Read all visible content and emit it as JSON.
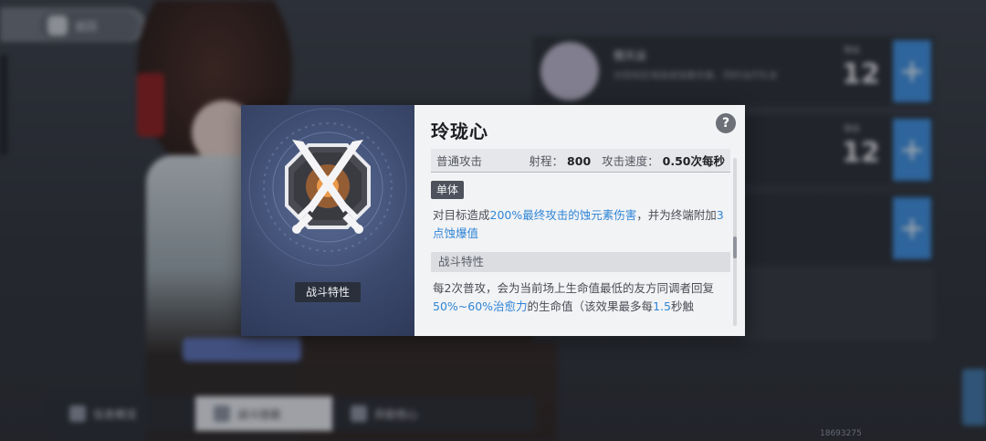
{
  "background": {
    "back_button_label": "返回",
    "refresh_icon": "refresh-icon",
    "help_icon": "?",
    "slots": [
      {
        "name": "闇天运",
        "desc": "对目标区域造成蚀素伤害，同时治疗队友",
        "level": "12",
        "level_tag": "等级",
        "plus": "+"
      },
      {
        "name": "",
        "desc": "",
        "level": "12",
        "level_tag": "等级",
        "plus": "+"
      },
      {
        "name": "",
        "desc": "",
        "level": "",
        "level_tag": "",
        "plus": "+"
      }
    ],
    "tabs": [
      {
        "label": "信息概览",
        "active": false
      },
      {
        "label": "战斗技能",
        "active": true
      },
      {
        "label": "异能核心",
        "active": false
      }
    ],
    "watermark": "18693275"
  },
  "card": {
    "icon_label": "战斗特性",
    "title": "玲珑心",
    "help": "?",
    "normal_attack": {
      "label": "普通攻击",
      "range_label": "射程：",
      "range_value": "800",
      "speed_label": "攻击速度：",
      "speed_value": "0.50次每秒"
    },
    "tag": "单体",
    "desc1": {
      "p1": "对目标造成",
      "h1": "200%最终攻击的蚀元素伤害",
      "p2": "，并为终端附加",
      "h2": "3点蚀爆值"
    },
    "section_title": "战斗特性",
    "desc2": {
      "p1": "每2次普攻，会为当前场上生命值最低的友方同调者回复",
      "h1": "50%~60%治愈力",
      "p2": "的生命值（该效果最多每",
      "h2": "1.5",
      "p3": "秒触"
    }
  },
  "colors": {
    "accent_blue": "#3d8fe0",
    "highlight_text": "#2f85d6",
    "card_icon_bg": "#3c4a6e",
    "emblem_orange": "#e07a2a"
  }
}
